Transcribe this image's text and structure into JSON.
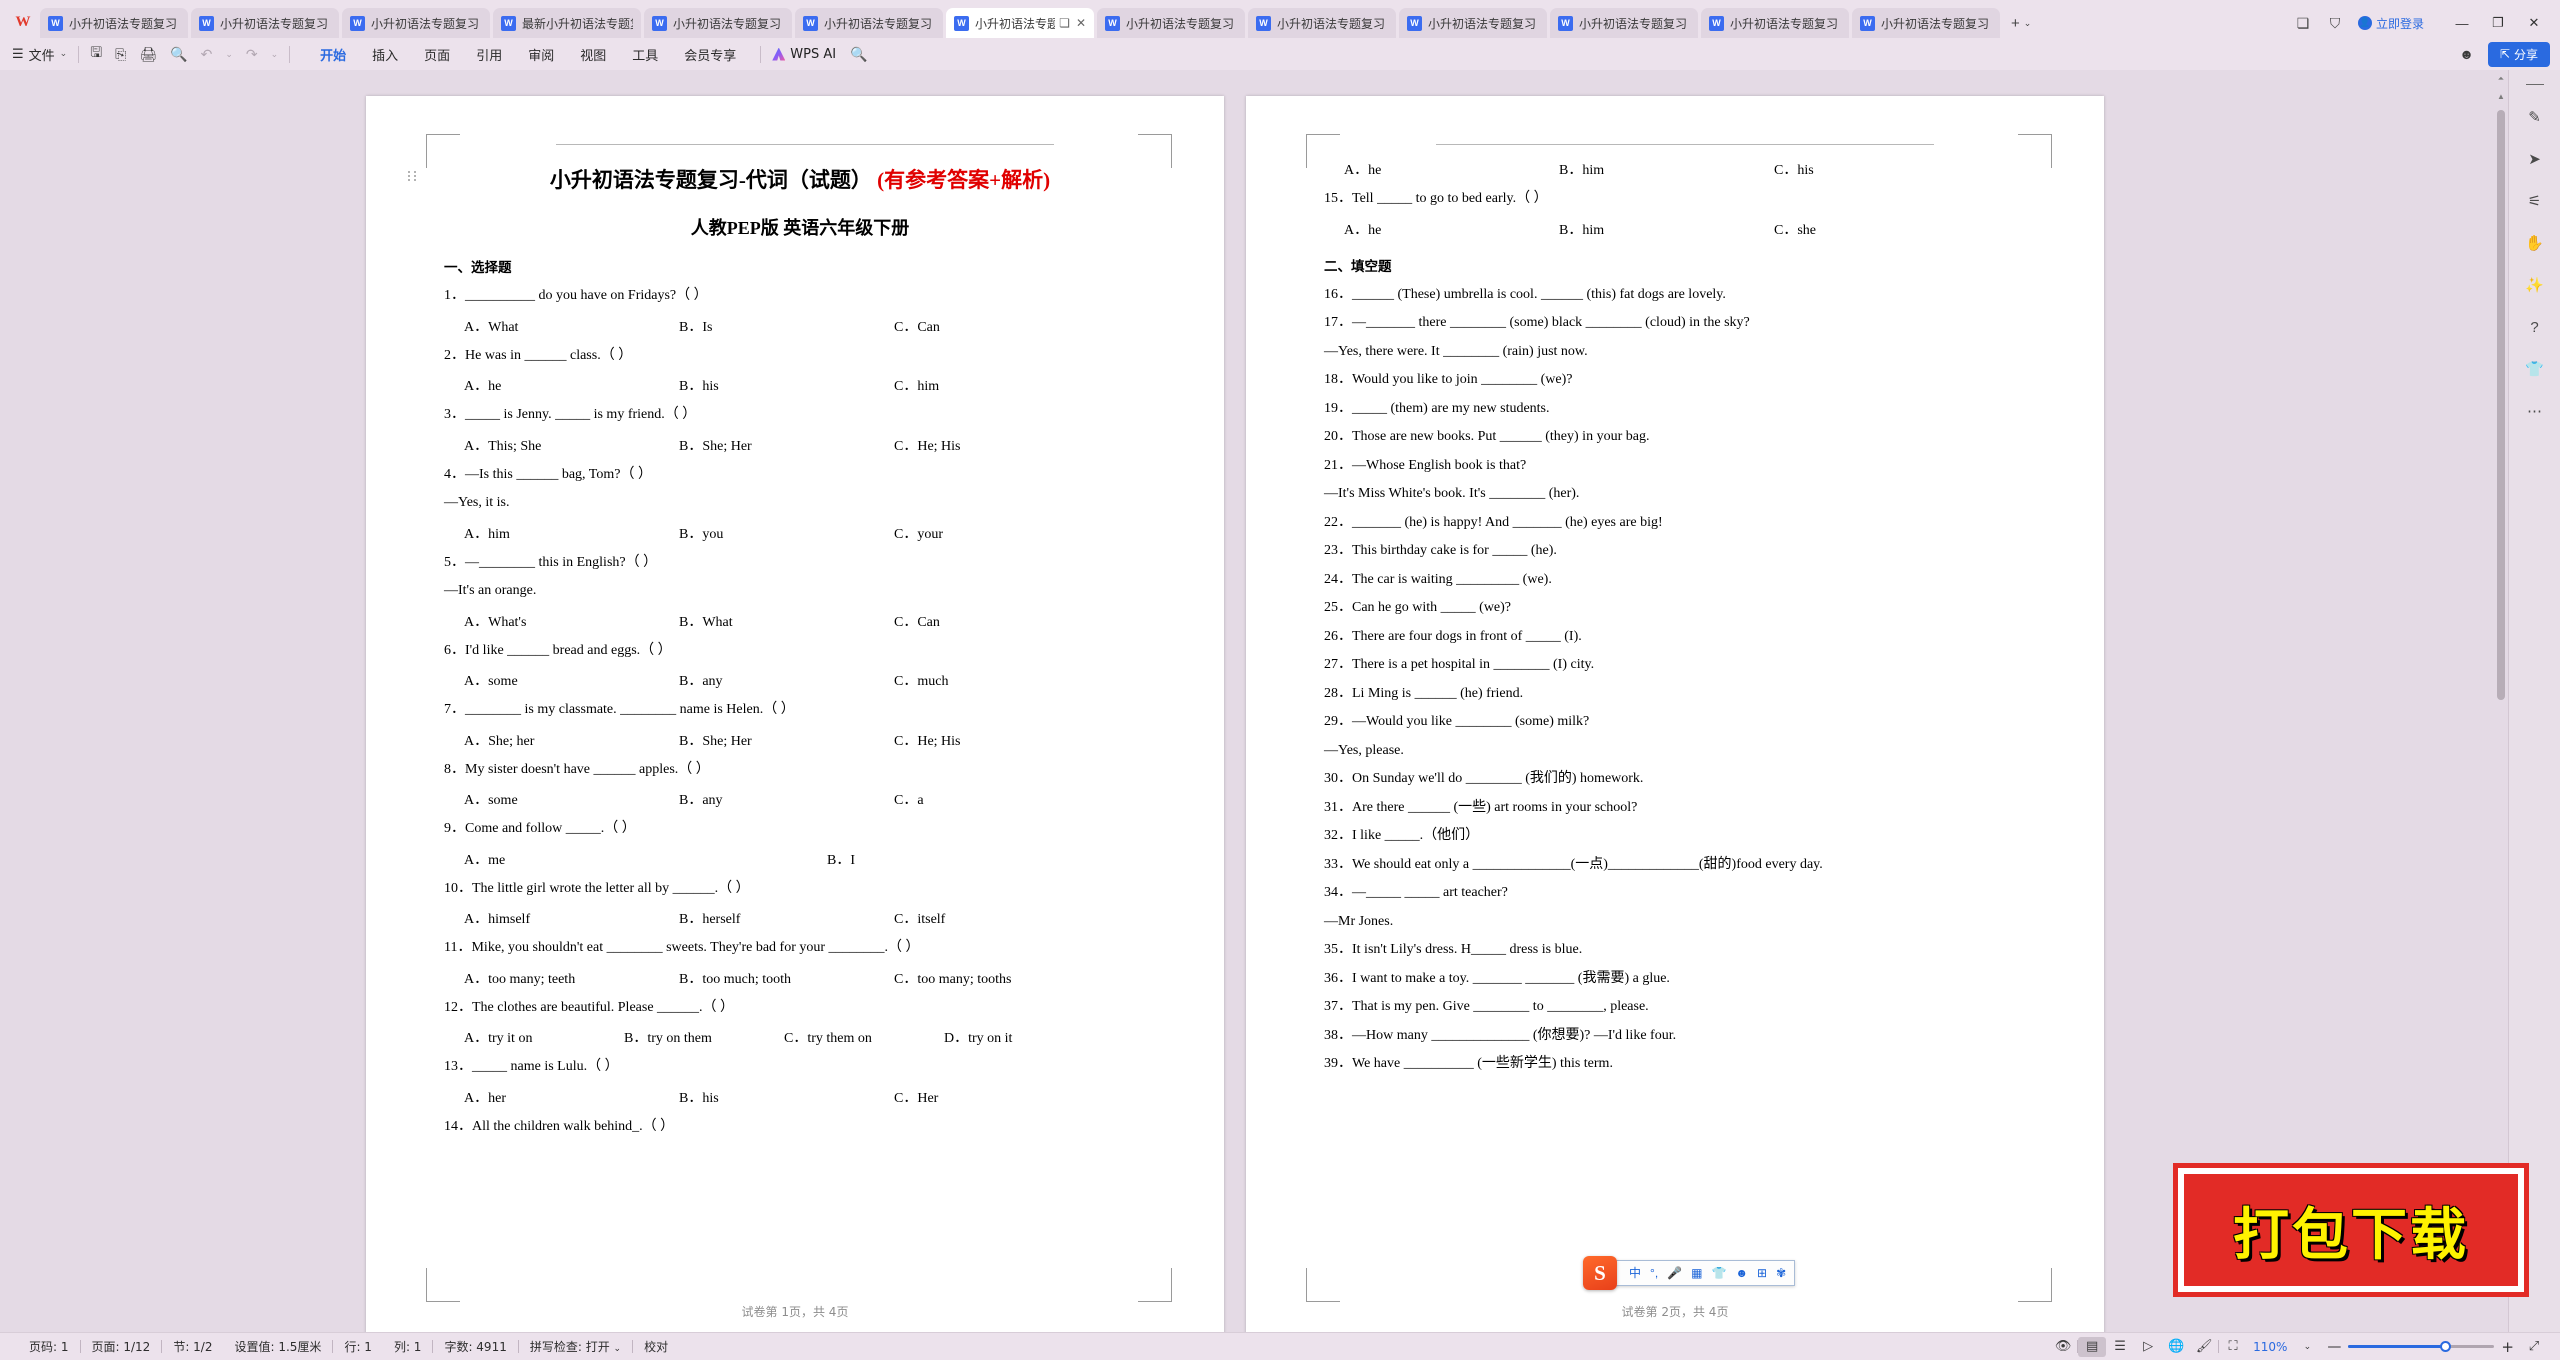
{
  "app": {
    "logo": "W",
    "tabs": [
      {
        "label": "小升初语法专题复习",
        "icon": "W",
        "active": false
      },
      {
        "label": "小升初语法专题复习",
        "icon": "W",
        "active": false
      },
      {
        "label": "小升初语法专题复习",
        "icon": "W",
        "active": false
      },
      {
        "label": "最新小升初语法专题复习",
        "icon": "W",
        "active": false
      },
      {
        "label": "小升初语法专题复习",
        "icon": "W",
        "active": false
      },
      {
        "label": "小升初语法专题复习",
        "icon": "W",
        "active": false
      },
      {
        "label": "小升初语法专题复习",
        "icon": "W",
        "active": true
      },
      {
        "label": "小升初语法专题复习",
        "icon": "W",
        "active": false
      },
      {
        "label": "小升初语法专题复习",
        "icon": "W",
        "active": false
      },
      {
        "label": "小升初语法专题复习",
        "icon": "W",
        "active": false
      },
      {
        "label": "小升初语法专题复习",
        "icon": "W",
        "active": false
      },
      {
        "label": "小升初语法专题复习",
        "icon": "W",
        "active": false
      },
      {
        "label": "小升初语法专题复习",
        "icon": "W",
        "active": false
      }
    ],
    "new_tab": "+",
    "new_tab_chevron": "⌄",
    "login_label": "立即登录",
    "window_min": "—",
    "window_restore": "❐",
    "window_close": "✕"
  },
  "ribbon": {
    "file_label": "文件",
    "menus": [
      {
        "label": "开始",
        "active": true
      },
      {
        "label": "插入",
        "active": false
      },
      {
        "label": "页面",
        "active": false
      },
      {
        "label": "引用",
        "active": false
      },
      {
        "label": "审阅",
        "active": false
      },
      {
        "label": "视图",
        "active": false
      },
      {
        "label": "工具",
        "active": false
      },
      {
        "label": "会员专享",
        "active": false
      }
    ],
    "wps_ai": "WPS AI",
    "share_label": "分享"
  },
  "document": {
    "title_main": "小升初语法专题复习-代词（试题）",
    "title_red": "(有参考答案+解析)",
    "subtitle": "人教PEP版 英语六年级下册",
    "section_one": "一、选择题",
    "section_two": "二、填空题",
    "page1_footer": "试卷第 1页，共 4页",
    "page2_footer": "试卷第 2页，共 4页",
    "page1_items": [
      {
        "type": "q",
        "text": "1．__________ do you have on Fridays?（   ）"
      },
      {
        "type": "opt3",
        "a": "A．What",
        "b": "B．Is",
        "c": "C．Can"
      },
      {
        "type": "q",
        "text": "2．He was in ______ class.（    ）"
      },
      {
        "type": "opt3",
        "a": "A．he",
        "b": "B．his",
        "c": "C．him"
      },
      {
        "type": "q",
        "text": "3．_____ is Jenny. _____ is my friend.（  ）"
      },
      {
        "type": "opt3",
        "a": "A．This; She",
        "b": "B．She; Her",
        "c": "C．He; His"
      },
      {
        "type": "q",
        "text": "4．—Is this ______ bag, Tom?（  ）"
      },
      {
        "type": "qc",
        "text": "—Yes, it is."
      },
      {
        "type": "opt3",
        "a": "A．him",
        "b": "B．you",
        "c": "C．your"
      },
      {
        "type": "q",
        "text": "5．—________ this in English?（    ）"
      },
      {
        "type": "qc",
        "text": "—It's an orange."
      },
      {
        "type": "opt3",
        "a": "A．What's",
        "b": "B．What",
        "c": "C．Can"
      },
      {
        "type": "q",
        "text": "6．I'd like ______ bread and eggs.（          ）"
      },
      {
        "type": "opt3",
        "a": "A．some",
        "b": "B．any",
        "c": "C．much"
      },
      {
        "type": "q",
        "text": "7．________ is my classmate. ________ name is Helen.（        ）"
      },
      {
        "type": "opt3",
        "a": "A．She; her",
        "b": "B．She; Her",
        "c": "C．He; His"
      },
      {
        "type": "q",
        "text": "8．My sister doesn't have ______ apples.（        ）"
      },
      {
        "type": "opt3",
        "a": "A．some",
        "b": "B．any",
        "c": "C．a"
      },
      {
        "type": "q",
        "text": "9．Come and follow _____.（  ）"
      },
      {
        "type": "opt2",
        "a": "A．me",
        "b": "B．I"
      },
      {
        "type": "q",
        "text": "10．The little girl wrote the letter all by ______.（       ）"
      },
      {
        "type": "opt3",
        "a": "A．himself",
        "b": "B．herself",
        "c": "C．itself"
      },
      {
        "type": "q",
        "text": "11．Mike, you shouldn't eat ________ sweets. They're bad for your ________.（        ）"
      },
      {
        "type": "opt3w",
        "a": "A．too many; teeth",
        "b": "B．too much; tooth",
        "c": "C．too many; tooths"
      },
      {
        "type": "q",
        "text": "12．The clothes are beautiful. Please ______.（  ）"
      },
      {
        "type": "opt4",
        "a": "A．try it on",
        "b": "B．try on them",
        "c": "C．try them on",
        "d": "D．try on it"
      },
      {
        "type": "q",
        "text": "13．_____ name is Lulu.（    ）"
      },
      {
        "type": "opt3",
        "a": "A．her",
        "b": "B．his",
        "c": "C．Her"
      },
      {
        "type": "q",
        "text": "14．All the children walk behind_.（  ）"
      }
    ],
    "page2_items": [
      {
        "type": "opt3",
        "a": "A．he",
        "b": "B．him",
        "c": "C．his"
      },
      {
        "type": "q",
        "text": "15．Tell _____ to go to bed early.（  ）"
      },
      {
        "type": "opt3",
        "a": "A．he",
        "b": "B．him",
        "c": "C．she"
      },
      {
        "type": "h2",
        "text": "二、填空题"
      },
      {
        "type": "q",
        "text": "16．______ (These) umbrella is cool. ______ (this) fat dogs are lovely."
      },
      {
        "type": "q",
        "text": "17．—_______ there ________ (some) black ________ (cloud) in the sky?"
      },
      {
        "type": "qc",
        "text": "—Yes, there were. It ________ (rain) just now."
      },
      {
        "type": "q",
        "text": "18．Would you like to join ________ (we)?"
      },
      {
        "type": "q",
        "text": "19．_____ (them) are my new students."
      },
      {
        "type": "q",
        "text": "20．Those are new books. Put ______ (they) in your bag."
      },
      {
        "type": "q",
        "text": "21．—Whose English book is that?"
      },
      {
        "type": "qc",
        "text": "—It's Miss White's book. It's ________ (her)."
      },
      {
        "type": "q",
        "text": "22．_______ (he) is happy! And _______ (he) eyes are big!"
      },
      {
        "type": "q",
        "text": "23．This birthday cake is for _____ (he)."
      },
      {
        "type": "q",
        "text": "24．The car is waiting _________ (we)."
      },
      {
        "type": "q",
        "text": "25．Can he go with _____ (we)?"
      },
      {
        "type": "q",
        "text": "26．There are four dogs in front of _____ (I)."
      },
      {
        "type": "q",
        "text": "27．There is a pet hospital in ________ (I) city."
      },
      {
        "type": "q",
        "text": "28．Li Ming is ______ (he) friend."
      },
      {
        "type": "q",
        "text": "29．—Would you like ________ (some) milk?"
      },
      {
        "type": "qc",
        "text": "—Yes, please."
      },
      {
        "type": "q",
        "text": "30．On Sunday we'll do ________ (我们的) homework."
      },
      {
        "type": "q",
        "text": "31．Are there ______ (一些) art rooms in your school?"
      },
      {
        "type": "q",
        "text": "32．I like _____.（他们）"
      },
      {
        "type": "q",
        "text": "33．We should eat only a ______________(一点)_____________(甜的)food every day."
      },
      {
        "type": "q",
        "text": "34．—_____ _____ art teacher?"
      },
      {
        "type": "qc",
        "text": "—Mr Jones."
      },
      {
        "type": "q",
        "text": "35．It isn't Lily's dress. H_____ dress is blue."
      },
      {
        "type": "q",
        "text": "36．I want to make a toy. _______ _______ (我需要) a glue."
      },
      {
        "type": "q",
        "text": "37．That is my pen. Give ________ to ________, please."
      },
      {
        "type": "q",
        "text": "38．—How many ______________ (你想要)? —I'd like four."
      },
      {
        "type": "q",
        "text": "39．We have __________ (一些新学生) this term."
      }
    ]
  },
  "ime": {
    "logo": "S",
    "buttons": [
      "中",
      "°,",
      "🎤",
      "⌨",
      "👕",
      "😀",
      "⊞",
      "🅰"
    ]
  },
  "watermark": {
    "text": "打包下载",
    "bg_color": "#e22b26",
    "text_color": "#fff200"
  },
  "sidebar_right": {
    "icons": [
      "pen-icon",
      "cursor-icon",
      "sliders-icon",
      "hand-icon",
      "magic-wand-icon",
      "help-icon",
      "shirt-icon",
      "more-icon"
    ]
  },
  "statusbar": {
    "page_no": "页码: 1",
    "page_of": "页面: 1/12",
    "section": "节: 1/2",
    "setting": "设置值: 1.5厘米",
    "row": "行: 1",
    "col": "列: 1",
    "words": "字数: 4911",
    "spellcheck": "拼写检查: 打开",
    "proof": "校对",
    "zoom": "110%",
    "view_icons": [
      "eye-icon",
      "page-view-icon",
      "outline-view-icon",
      "web-view-icon",
      "globe-icon",
      "brush-icon",
      "fullscreen-icon"
    ]
  }
}
